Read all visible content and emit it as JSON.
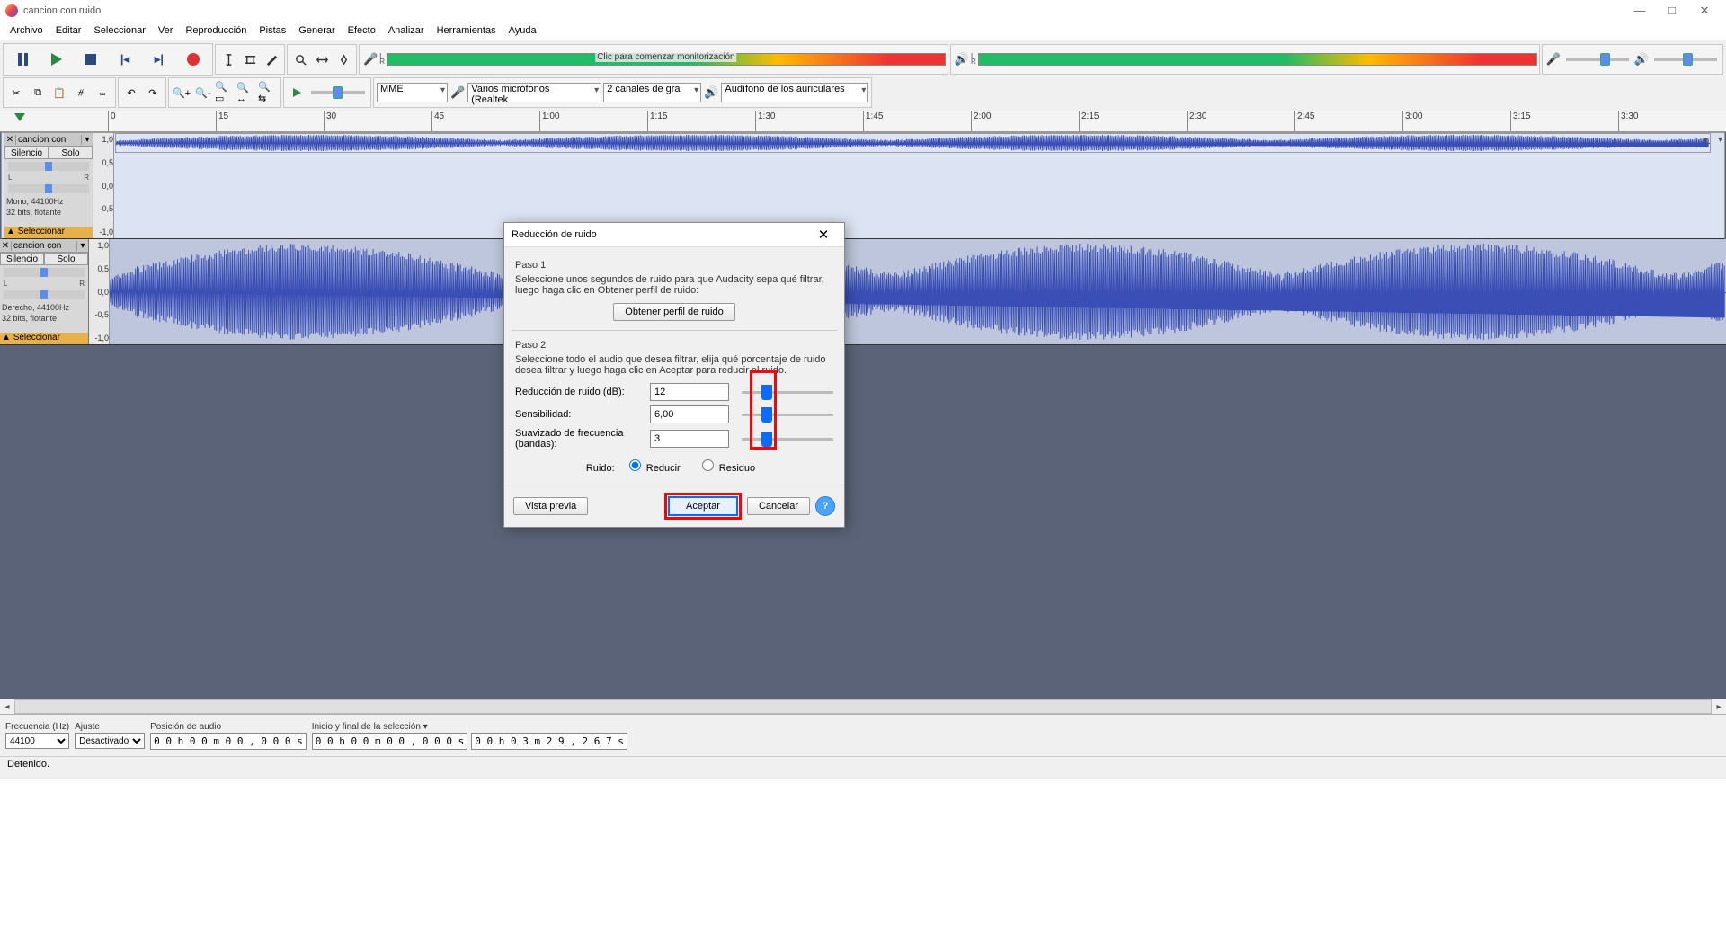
{
  "window": {
    "title": "cancion con ruido"
  },
  "menu": [
    "Archivo",
    "Editar",
    "Seleccionar",
    "Ver",
    "Reproducción",
    "Pistas",
    "Generar",
    "Efecto",
    "Analizar",
    "Herramientas",
    "Ayuda"
  ],
  "rec_meter_hint": "Clic para comenzar monitorización",
  "host": {
    "api": "MME",
    "input": "Varios micrófonos (Realtek",
    "channels": "2 canales de gra",
    "output": "Audífono de los auriculares"
  },
  "timeline": [
    "0",
    "15",
    "30",
    "45",
    "1:00",
    "1:15",
    "1:30",
    "1:45",
    "2:00",
    "2:15",
    "2:30",
    "2:45",
    "3:00",
    "3:15",
    "3:30"
  ],
  "tracks": [
    {
      "name": "cancion con",
      "btn_mute": "Silencio",
      "btn_solo": "Solo",
      "info1": "Mono, 44100Hz",
      "info2": "32 bits, flotante",
      "selbar": "Seleccionar",
      "scale": [
        "1,0",
        "0,5",
        "0,0",
        "-0,5",
        "-1,0"
      ]
    },
    {
      "name": "cancion con",
      "btn_mute": "Silencio",
      "btn_solo": "Solo",
      "info1": "Derecho, 44100Hz",
      "info2": "32 bits, flotante",
      "selbar": "Seleccionar",
      "scale": [
        "1,0",
        "0,5",
        "0,0",
        "-0,5",
        "-1,0"
      ]
    }
  ],
  "dialog": {
    "title": "Reducción de ruido",
    "step1": "Paso 1",
    "step1_desc": "Seleccione unos segundos de ruido para que Audacity sepa qué filtrar, luego haga clic en Obtener perfil de ruido:",
    "btn_profile": "Obtener perfil de ruido",
    "step2": "Paso 2",
    "step2_desc": "Seleccione todo el audio que desea filtrar, elija qué porcentaje de ruido desea filtrar y luego haga clic en Aceptar para reducir el ruido.",
    "p_reduction_label": "Reducción de ruido (dB):",
    "p_reduction_val": "12",
    "p_sens_label": "Sensibilidad:",
    "p_sens_val": "6,00",
    "p_smooth_label": "Suavizado de frecuencia (bandas):",
    "p_smooth_val": "3",
    "noise_label": "Ruido:",
    "opt_reduce": "Reducir",
    "opt_residue": "Residuo",
    "btn_preview": "Vista previa",
    "btn_ok": "Aceptar",
    "btn_cancel": "Cancelar"
  },
  "bottom": {
    "rate_label": "Frecuencia (Hz)",
    "rate_val": "44100",
    "snap_label": "Ajuste",
    "snap_val": "Desactivado",
    "pos_label": "Posición de audio",
    "pos_val": "0 0 h 0 0 m 0 0 , 0 0 0 s",
    "sel_label": "Inicio y final de la selección",
    "sel_start": "0 0 h 0 0 m 0 0 , 0 0 0 s",
    "sel_end": "0 0 h 0 3 m 2 9 , 2 6 7 s"
  },
  "status": "Detenido."
}
